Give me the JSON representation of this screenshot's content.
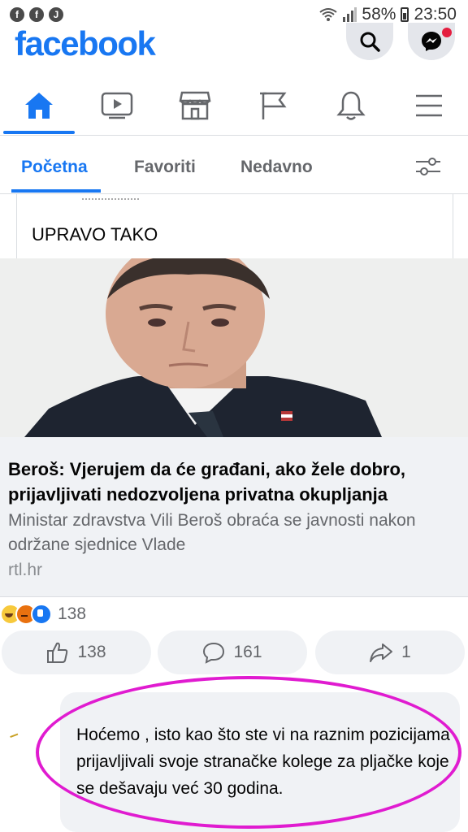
{
  "status_bar": {
    "notification_icons": [
      "facebook-icon",
      "facebook-icon",
      "j-notification-icon"
    ],
    "notif_letters": [
      "f",
      "f",
      "J"
    ],
    "battery": "58%",
    "time": "23:50"
  },
  "header": {
    "logo": "facebook",
    "brand_color": "#1877f2"
  },
  "nav": {
    "items": [
      "home-icon",
      "watch-icon",
      "marketplace-icon",
      "pages-flag-icon",
      "notifications-bell-icon",
      "menu-icon"
    ],
    "active_index": 0
  },
  "feed_tabs": {
    "tabs": [
      "Početna",
      "Favoriti",
      "Nedavno"
    ],
    "active": "Početna"
  },
  "post": {
    "shared_text": "UPRAVO TAKO",
    "link_title": "Beroš: Vjerujem da će građani, ako žele dobro, prijavljivati nedozvoljena privatna okupljanja",
    "link_description": "Ministar zdravstva Vili Beroš obraća se javnosti nakon održane sjednice Vlade",
    "link_domain": "rtl.hr",
    "reaction_icons": [
      "haha-icon",
      "angry-icon",
      "like-icon"
    ],
    "reactions_count": "138",
    "actions": {
      "like_count": "138",
      "comment_count": "161",
      "share_count": "1"
    }
  },
  "comment": {
    "text": "Hoćemo , isto kao što ste vi na raznim pozicijama prijavljivali svoje stranačke kolege za pljačke koje se dešavaju već 30 godina.",
    "highlight_color": "#e01bd0"
  }
}
